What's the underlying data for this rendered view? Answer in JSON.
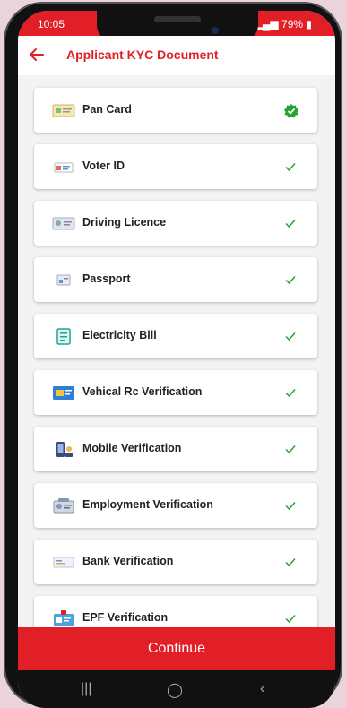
{
  "status": {
    "time": "10:05",
    "battery": "79%"
  },
  "header": {
    "title": "Applicant KYC Document"
  },
  "documents": [
    {
      "label": "Pan Card",
      "icon": "pan-card-icon",
      "status": "verified-filled"
    },
    {
      "label": "Voter ID",
      "icon": "voter-id-icon",
      "status": "verified"
    },
    {
      "label": "Driving Licence",
      "icon": "driving-licence-icon",
      "status": "verified"
    },
    {
      "label": "Passport",
      "icon": "passport-icon",
      "status": "verified"
    },
    {
      "label": "Electricity Bill",
      "icon": "electricity-bill-icon",
      "status": "verified"
    },
    {
      "label": "Vehical Rc Verification",
      "icon": "vehicle-rc-icon",
      "status": "verified"
    },
    {
      "label": "Mobile Verification",
      "icon": "mobile-verification-icon",
      "status": "verified"
    },
    {
      "label": "Employment Verification",
      "icon": "employment-icon",
      "status": "verified"
    },
    {
      "label": "Bank Verification",
      "icon": "bank-icon",
      "status": "verified"
    },
    {
      "label": "EPF Verification",
      "icon": "epf-icon",
      "status": "verified"
    }
  ],
  "footer": {
    "continue_label": "Continue"
  },
  "colors": {
    "accent": "#e21f26",
    "check": "#22a52f",
    "background": "#f3f3f4"
  }
}
